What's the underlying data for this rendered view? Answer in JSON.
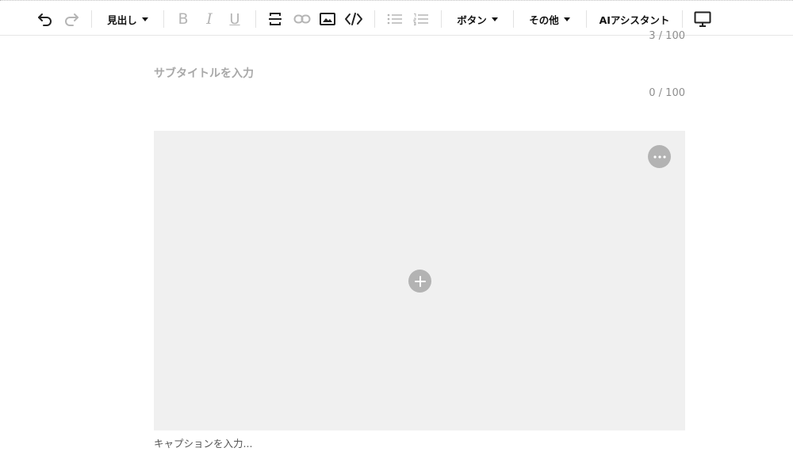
{
  "toolbar": {
    "undo_icon": "undo-icon",
    "redo_icon": "redo-icon",
    "heading_label": "見出し",
    "bold_label": "B",
    "italic_label": "I",
    "underline_label": "U",
    "strike_icon": "strikethrough-icon",
    "link_icon": "link-icon",
    "image_icon": "image-icon",
    "code_icon": "code-icon",
    "bullet_list_icon": "bullet-list-icon",
    "numbered_list_icon": "numbered-list-icon",
    "button_label": "ボタン",
    "other_label": "その他",
    "ai_label": "AIアシスタント",
    "preview_icon": "monitor-icon"
  },
  "title_counter": "3 / 100",
  "subtitle": {
    "placeholder": "サブタイトルを入力",
    "counter": "0 / 100"
  },
  "image_block": {
    "more_icon": "more-icon",
    "add_icon": "plus-icon",
    "caption_placeholder": "キャプションを入力..."
  },
  "colors": {
    "toolbar_border": "#e6e6e6",
    "image_bg": "#f0f0f0",
    "circle_button": "#b3b3b3",
    "placeholder": "#a8a8a8",
    "disabled_icon": "#b5b5b5"
  }
}
